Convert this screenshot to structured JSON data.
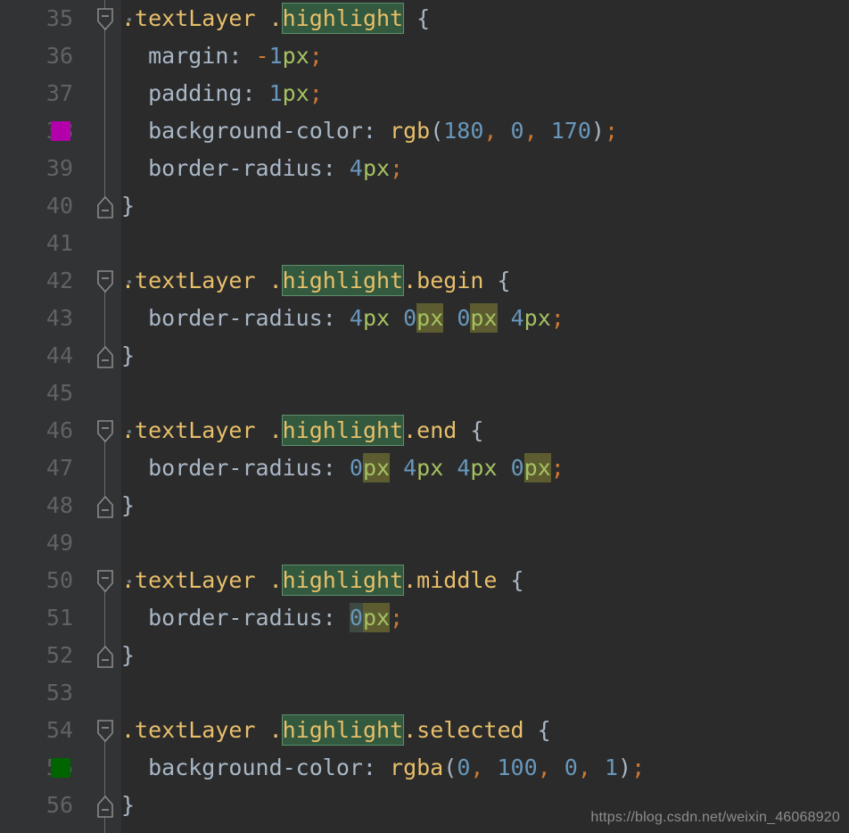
{
  "editor": {
    "theme": "darcula",
    "background": "#2b2b2b",
    "gutter_background": "#313335",
    "line_number_color": "#606366",
    "line_height_px": 42,
    "first_line": 35,
    "last_line": 56
  },
  "colors": {
    "selector": "#e8bf6a",
    "text": "#a9b7c6",
    "number": "#6897bb",
    "unit": "#a5c261",
    "punctuation": "#cc7832",
    "function": "#e8bf6a",
    "search_highlight_bg": "#33593f",
    "search_highlight_border": "#5d8f6d",
    "occurrence_highlight_bg": "#5c5c30",
    "swatch_magenta": "#b400aa",
    "swatch_green": "#006400"
  },
  "lines": [
    {
      "number": "35",
      "fold": "open",
      "indent_dot": true,
      "swatch": null,
      "tokens": [
        {
          "text": ".textLayer ",
          "cls": "t-sel"
        },
        {
          "text": ".",
          "cls": "t-sel"
        },
        {
          "text": "highlight",
          "cls": "t-sel",
          "hl": "word"
        },
        {
          "text": " ",
          "cls": "t-prop"
        },
        {
          "text": "{",
          "cls": "t-brace"
        }
      ]
    },
    {
      "number": "36",
      "fold": null,
      "indent_dot": false,
      "swatch": null,
      "tokens": [
        {
          "text": "  margin: ",
          "cls": "t-prop"
        },
        {
          "text": "-",
          "cls": "t-punc"
        },
        {
          "text": "1",
          "cls": "t-num"
        },
        {
          "text": "px",
          "cls": "t-unit"
        },
        {
          "text": ";",
          "cls": "t-punc"
        }
      ]
    },
    {
      "number": "37",
      "fold": null,
      "indent_dot": false,
      "swatch": null,
      "tokens": [
        {
          "text": "  padding: ",
          "cls": "t-prop"
        },
        {
          "text": "1",
          "cls": "t-num"
        },
        {
          "text": "px",
          "cls": "t-unit"
        },
        {
          "text": ";",
          "cls": "t-punc"
        }
      ]
    },
    {
      "number": "38",
      "fold": null,
      "indent_dot": false,
      "swatch": "#b400aa",
      "tokens": [
        {
          "text": "  background-color: ",
          "cls": "t-prop"
        },
        {
          "text": "rgb",
          "cls": "t-fn"
        },
        {
          "text": "(",
          "cls": "t-paren"
        },
        {
          "text": "180",
          "cls": "t-num"
        },
        {
          "text": ",",
          "cls": "t-punc"
        },
        {
          "text": " ",
          "cls": "t-prop"
        },
        {
          "text": "0",
          "cls": "t-num"
        },
        {
          "text": ",",
          "cls": "t-punc"
        },
        {
          "text": " ",
          "cls": "t-prop"
        },
        {
          "text": "170",
          "cls": "t-num"
        },
        {
          "text": ")",
          "cls": "t-paren"
        },
        {
          "text": ";",
          "cls": "t-punc"
        }
      ]
    },
    {
      "number": "39",
      "fold": null,
      "indent_dot": false,
      "swatch": null,
      "tokens": [
        {
          "text": "  border-radius: ",
          "cls": "t-prop"
        },
        {
          "text": "4",
          "cls": "t-num"
        },
        {
          "text": "px",
          "cls": "t-unit"
        },
        {
          "text": ";",
          "cls": "t-punc"
        }
      ]
    },
    {
      "number": "40",
      "fold": "close",
      "indent_dot": false,
      "swatch": null,
      "tokens": [
        {
          "text": "}",
          "cls": "t-brace"
        }
      ]
    },
    {
      "number": "41",
      "fold": null,
      "indent_dot": false,
      "swatch": null,
      "tokens": []
    },
    {
      "number": "42",
      "fold": "open",
      "indent_dot": true,
      "swatch": null,
      "tokens": [
        {
          "text": ".textLayer ",
          "cls": "t-sel"
        },
        {
          "text": ".",
          "cls": "t-sel"
        },
        {
          "text": "highlight",
          "cls": "t-sel",
          "hl": "word"
        },
        {
          "text": ".begin ",
          "cls": "t-sel"
        },
        {
          "text": "{",
          "cls": "t-brace"
        }
      ]
    },
    {
      "number": "43",
      "fold": null,
      "indent_dot": false,
      "swatch": null,
      "tokens": [
        {
          "text": "  border-radius: ",
          "cls": "t-prop"
        },
        {
          "text": "4",
          "cls": "t-num"
        },
        {
          "text": "px",
          "cls": "t-unit"
        },
        {
          "text": " ",
          "cls": "t-prop"
        },
        {
          "text": "0",
          "cls": "t-num"
        },
        {
          "text": "px",
          "cls": "t-unit",
          "hl": "px"
        },
        {
          "text": " ",
          "cls": "t-prop"
        },
        {
          "text": "0",
          "cls": "t-num"
        },
        {
          "text": "px",
          "cls": "t-unit",
          "hl": "px"
        },
        {
          "text": " ",
          "cls": "t-prop"
        },
        {
          "text": "4",
          "cls": "t-num"
        },
        {
          "text": "px",
          "cls": "t-unit"
        },
        {
          "text": ";",
          "cls": "t-punc"
        }
      ]
    },
    {
      "number": "44",
      "fold": "close",
      "indent_dot": false,
      "swatch": null,
      "tokens": [
        {
          "text": "}",
          "cls": "t-brace"
        }
      ]
    },
    {
      "number": "45",
      "fold": null,
      "indent_dot": false,
      "swatch": null,
      "tokens": []
    },
    {
      "number": "46",
      "fold": "open",
      "indent_dot": true,
      "swatch": null,
      "tokens": [
        {
          "text": ".textLayer ",
          "cls": "t-sel"
        },
        {
          "text": ".",
          "cls": "t-sel"
        },
        {
          "text": "highlight",
          "cls": "t-sel",
          "hl": "word"
        },
        {
          "text": ".end ",
          "cls": "t-sel"
        },
        {
          "text": "{",
          "cls": "t-brace"
        }
      ]
    },
    {
      "number": "47",
      "fold": null,
      "indent_dot": false,
      "swatch": null,
      "tokens": [
        {
          "text": "  border-radius: ",
          "cls": "t-prop"
        },
        {
          "text": "0",
          "cls": "t-num"
        },
        {
          "text": "px",
          "cls": "t-unit",
          "hl": "px"
        },
        {
          "text": " ",
          "cls": "t-prop"
        },
        {
          "text": "4",
          "cls": "t-num"
        },
        {
          "text": "px",
          "cls": "t-unit"
        },
        {
          "text": " ",
          "cls": "t-prop"
        },
        {
          "text": "4",
          "cls": "t-num"
        },
        {
          "text": "px",
          "cls": "t-unit"
        },
        {
          "text": " ",
          "cls": "t-prop"
        },
        {
          "text": "0",
          "cls": "t-num"
        },
        {
          "text": "px",
          "cls": "t-unit",
          "hl": "px"
        },
        {
          "text": ";",
          "cls": "t-punc"
        }
      ]
    },
    {
      "number": "48",
      "fold": "close",
      "indent_dot": false,
      "swatch": null,
      "tokens": [
        {
          "text": "}",
          "cls": "t-brace"
        }
      ]
    },
    {
      "number": "49",
      "fold": null,
      "indent_dot": false,
      "swatch": null,
      "tokens": []
    },
    {
      "number": "50",
      "fold": "open",
      "indent_dot": true,
      "swatch": null,
      "tokens": [
        {
          "text": ".textLayer ",
          "cls": "t-sel"
        },
        {
          "text": ".",
          "cls": "t-sel"
        },
        {
          "text": "highlight",
          "cls": "t-sel",
          "hl": "word"
        },
        {
          "text": ".middle ",
          "cls": "t-sel"
        },
        {
          "text": "{",
          "cls": "t-brace"
        }
      ]
    },
    {
      "number": "51",
      "fold": null,
      "indent_dot": false,
      "swatch": null,
      "tokens": [
        {
          "text": "  border-radius: ",
          "cls": "t-prop"
        },
        {
          "text": "0",
          "cls": "t-num",
          "hl": "zero"
        },
        {
          "text": "px",
          "cls": "t-unit",
          "hl": "px"
        },
        {
          "text": ";",
          "cls": "t-punc"
        }
      ]
    },
    {
      "number": "52",
      "fold": "close",
      "indent_dot": false,
      "swatch": null,
      "tokens": [
        {
          "text": "}",
          "cls": "t-brace"
        }
      ]
    },
    {
      "number": "53",
      "fold": null,
      "indent_dot": false,
      "swatch": null,
      "tokens": []
    },
    {
      "number": "54",
      "fold": "open",
      "indent_dot": false,
      "swatch": null,
      "tokens": [
        {
          "text": ".textLayer ",
          "cls": "t-sel"
        },
        {
          "text": ".",
          "cls": "t-sel"
        },
        {
          "text": "highlight",
          "cls": "t-sel",
          "hl": "word"
        },
        {
          "text": ".selected ",
          "cls": "t-sel"
        },
        {
          "text": "{",
          "cls": "t-brace"
        }
      ]
    },
    {
      "number": "55",
      "fold": null,
      "indent_dot": false,
      "swatch": "#006400",
      "tokens": [
        {
          "text": "  background-color: ",
          "cls": "t-prop"
        },
        {
          "text": "rgba",
          "cls": "t-fn"
        },
        {
          "text": "(",
          "cls": "t-paren"
        },
        {
          "text": "0",
          "cls": "t-num"
        },
        {
          "text": ",",
          "cls": "t-punc"
        },
        {
          "text": " ",
          "cls": "t-prop"
        },
        {
          "text": "100",
          "cls": "t-num"
        },
        {
          "text": ",",
          "cls": "t-punc"
        },
        {
          "text": " ",
          "cls": "t-prop"
        },
        {
          "text": "0",
          "cls": "t-num"
        },
        {
          "text": ",",
          "cls": "t-punc"
        },
        {
          "text": " ",
          "cls": "t-prop"
        },
        {
          "text": "1",
          "cls": "t-num"
        },
        {
          "text": ")",
          "cls": "t-paren"
        },
        {
          "text": ";",
          "cls": "t-punc"
        }
      ]
    },
    {
      "number": "56",
      "fold": "close",
      "indent_dot": false,
      "swatch": null,
      "tokens": [
        {
          "text": "}",
          "cls": "t-brace"
        }
      ]
    }
  ],
  "watermark": {
    "text": "https://blog.csdn.net/weixin_46068920"
  }
}
